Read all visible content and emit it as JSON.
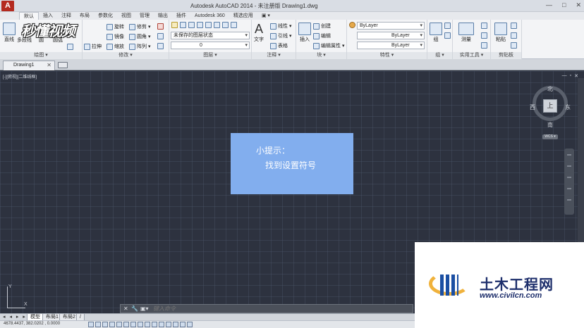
{
  "window": {
    "title": "Autodesk AutoCAD 2014 - 未注册版    Drawing1.dwg",
    "app_logo": "A",
    "controls": {
      "minimize": "—",
      "maximize": "□",
      "close": "✕"
    }
  },
  "ribbon_tabs": [
    "默认",
    "插入",
    "注释",
    "布局",
    "参数化",
    "视图",
    "管理",
    "输出",
    "插件",
    "Autodesk 360",
    "精选应用",
    "▣ ▾"
  ],
  "ribbon": {
    "draw": {
      "title": "绘图 ▾",
      "line": "直线",
      "polyline": "多段线",
      "circle": "圆",
      "arc": "圆弧"
    },
    "modify": {
      "title": "修改 ▾",
      "rotate": "旋转",
      "trim": "修剪 ▾",
      "mirror": "镜像",
      "fillet": "圆角 ▾",
      "stretch": "拉伸",
      "scale": "缩放",
      "array": "阵列 ▾"
    },
    "layers": {
      "title": "图层 ▾",
      "layer_state": "未保存的图层状态",
      "current_layer": "0"
    },
    "annotation": {
      "title": "注释 ▾",
      "text": "文字",
      "dimension": "线性 ▾",
      "leader": "引线 ▾",
      "table": "表格"
    },
    "block": {
      "title": "块 ▾",
      "insert": "插入",
      "create": "创建",
      "edit": "编辑",
      "edit_attr": "编辑属性 ▾"
    },
    "properties": {
      "title": "特性 ▾",
      "color": "ByLayer",
      "linetype": "ByLayer",
      "lineweight": "ByLayer"
    },
    "groups": {
      "title": "组 ▾",
      "group": "组"
    },
    "utilities": {
      "title": "实用工具 ▾",
      "measure": "测量"
    },
    "clipboard": {
      "title": "剪贴板",
      "paste": "粘贴"
    }
  },
  "watermark_top": "秒懂视频",
  "document_tab": {
    "label": "Drawing1",
    "close": "✕"
  },
  "canvas": {
    "view_label": "[-][俯视][二维线框]",
    "controls": [
      "—",
      "▫",
      "✕"
    ],
    "viewcube": {
      "top": "上",
      "north": "北",
      "south": "南",
      "east": "东",
      "west": "西",
      "wcs": "WCS ▾"
    }
  },
  "hint": {
    "title": "小提示：",
    "body": "找到设置符号"
  },
  "ucs": {
    "x": "X",
    "y": "Y"
  },
  "command_line": {
    "close": "✕",
    "tool": "🔧",
    "history": "▣▾",
    "placeholder": "键入命令"
  },
  "layout_tabs": {
    "arrows": "◂ ◂ ▸ ▸",
    "model": "模型",
    "layout1": "布局1",
    "layout2": "布局2",
    "add": "/"
  },
  "status_bar": {
    "coords": "4678.4437, 382.0202 , 0.0000"
  },
  "watermark_br": {
    "name": "土木工程网",
    "url": "www.civilcn.com"
  }
}
